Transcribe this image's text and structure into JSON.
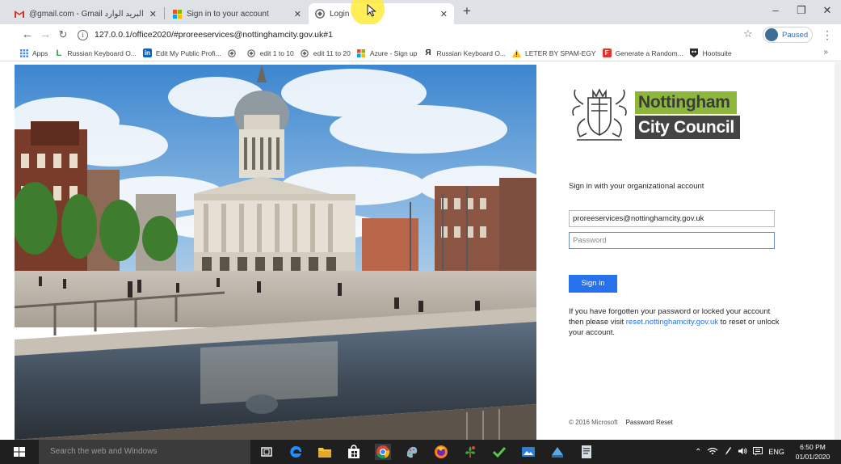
{
  "browser": {
    "tabs": [
      {
        "title": "@gmail.com - Gmail البريد الوارد",
        "favicon": "gmail-icon",
        "active": false
      },
      {
        "title": "Sign in to your account",
        "favicon": "microsoft-icon",
        "active": false
      },
      {
        "title": "Login -",
        "favicon": "globe-icon",
        "active": true
      }
    ],
    "address": {
      "url": "127.0.0.1/office2020/#proreeservices@nottinghamcity.gov.uk#1"
    },
    "profile": {
      "label": "Paused"
    },
    "bookmarks": [
      {
        "label": "Apps",
        "icon": "apps-grid-icon"
      },
      {
        "label": "Russian Keyboard O...",
        "icon": "green-l-icon"
      },
      {
        "label": "Edit My Public Profi...",
        "icon": "linkedin-icon"
      },
      {
        "label": "",
        "icon": "globe-icon"
      },
      {
        "label": "edit 1 to 10",
        "icon": "globe-icon"
      },
      {
        "label": "edit 11 to 20",
        "icon": "globe-icon"
      },
      {
        "label": "Azure - Sign up",
        "icon": "microsoft-icon"
      },
      {
        "label": "Russian Keyboard O...",
        "icon": "ya-icon"
      },
      {
        "label": "LETER BY SPAM-EGY",
        "icon": "warning-icon"
      },
      {
        "label": "Generate a Random...",
        "icon": "red-f-icon"
      },
      {
        "label": "Hootsuite",
        "icon": "hootsuite-icon"
      }
    ],
    "bookmarks_more": "»"
  },
  "login": {
    "logo_line1": "Nottingham",
    "logo_line2": "City Council",
    "heading": "Sign in with your organizational account",
    "email_value": "proreeservices@nottinghamcity.gov.uk",
    "password_placeholder": "Password",
    "signin_label": "Sign in",
    "help_text_before": "If you have forgotten your password or locked your account then please visit ",
    "help_link": "reset.nottinghamcity.gov.uk",
    "help_text_after": " to reset or unlock your account.",
    "copyright": "© 2016 Microsoft",
    "password_reset": "Password Reset"
  },
  "taskbar": {
    "search_placeholder": "Search the web and Windows",
    "language": "ENG",
    "time": "6:50 PM",
    "date": "01/01/2020"
  },
  "colors": {
    "accent": "#2672ec",
    "logo_green": "#8db63c",
    "logo_dark": "#444444"
  }
}
